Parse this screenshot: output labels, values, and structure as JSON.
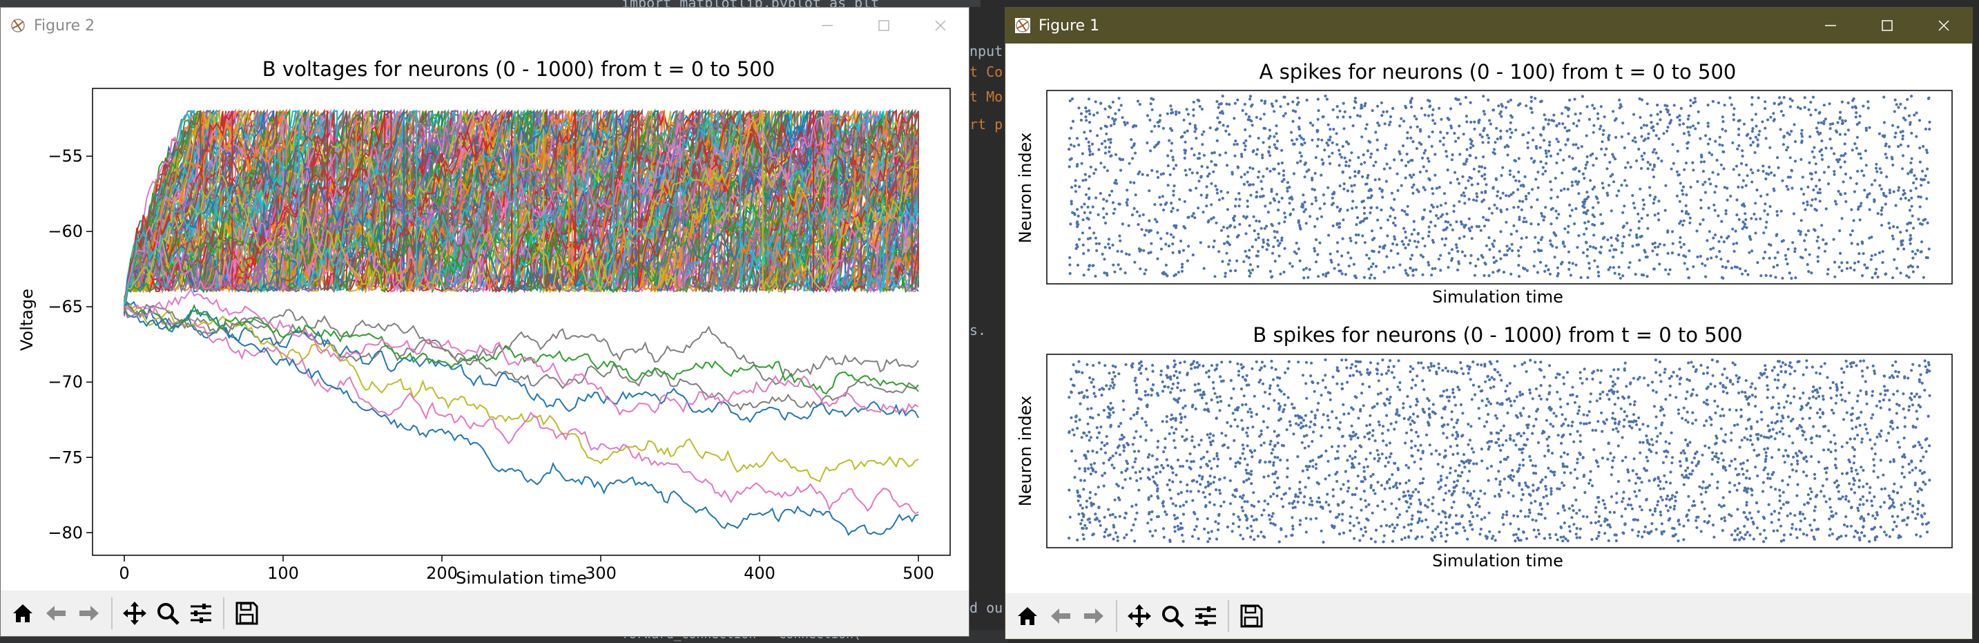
{
  "background": {
    "code_fragments": [
      "import matplotlib.pyplot as plt",
      "nput",
      "t Co",
      "t Mo",
      "rt p",
      "s.",
      "d ou",
      "forward_connection = Connection(",
      "connect_MNIST"
    ]
  },
  "figure2": {
    "window_title": "Figure 2",
    "plot": {
      "title": "B voltages for neurons (0 - 1000) from t = 0 to 500",
      "xlabel": "Simulation time",
      "ylabel": "Voltage",
      "x_ticks": [
        "0",
        "100",
        "200",
        "300",
        "400",
        "500"
      ],
      "y_ticks": [
        "−55",
        "−60",
        "−65",
        "−70",
        "−75",
        "−80"
      ]
    },
    "toolbar": {
      "coord_readout": ""
    }
  },
  "figure1": {
    "window_title": "Figure 1",
    "plot_a": {
      "title": "A spikes for neurons (0 - 100) from t = 0 to 500",
      "xlabel": "Simulation time",
      "ylabel": "Neuron index"
    },
    "plot_b": {
      "title": "B spikes for neurons (0 - 1000) from t = 0 to 500",
      "xlabel": "Simulation time",
      "ylabel": "Neuron index"
    },
    "toolbar": {
      "coord_readout": ""
    }
  },
  "toolbar_icons": [
    "home-icon",
    "back-icon",
    "forward-icon",
    "pan-icon",
    "zoom-icon",
    "configure-subplots-icon",
    "save-icon"
  ],
  "colors": {
    "scatter": "#4c72b0",
    "figure1_titlebar": "#53502a",
    "tab10": [
      "#1f77b4",
      "#ff7f0e",
      "#2ca02c",
      "#d62728",
      "#9467bd",
      "#8c564b",
      "#e377c2",
      "#7f7f7f",
      "#bcbd22",
      "#17becf"
    ]
  },
  "chart_data": [
    {
      "type": "line",
      "title": "B voltages for neurons (0 - 1000) from t = 0 to 500",
      "xlabel": "Simulation time",
      "ylabel": "Voltage",
      "xlim": [
        -20,
        520
      ],
      "ylim": [
        -81.5,
        -50.5
      ],
      "threshold": -52,
      "reset": -65,
      "rest": -65,
      "visible_low_traces_min_values": [
        -71.0,
        -72.5,
        -75.8,
        -77.2,
        -79.5
      ]
    },
    {
      "type": "scatter",
      "title": "A spikes for neurons (0 - 100) from t = 0 to 500",
      "xlabel": "Simulation time",
      "ylabel": "Neuron index",
      "xlim": [
        0,
        500
      ],
      "ylim": [
        0,
        100
      ]
    },
    {
      "type": "scatter",
      "title": "B spikes for neurons (0 - 1000) from t = 0 to 500",
      "xlabel": "Simulation time",
      "ylabel": "Neuron index",
      "xlim": [
        0,
        500
      ],
      "ylim": [
        0,
        1000
      ]
    }
  ]
}
